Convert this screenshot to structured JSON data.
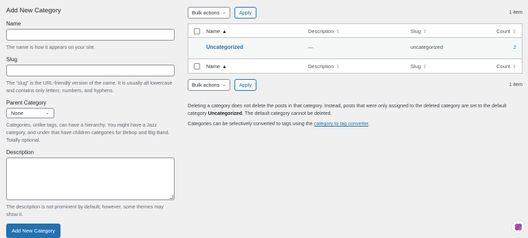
{
  "form": {
    "title": "Add New Category",
    "name_label": "Name",
    "name_value": "",
    "name_help": "The name is how it appears on your site.",
    "slug_label": "Slug",
    "slug_value": "",
    "slug_help": "The “slug” is the URL-friendly version of the name. It is usually all lowercase and contains only letters, numbers, and hyphens.",
    "parent_label": "Parent Category",
    "parent_selected": "None",
    "parent_help": "Categories, unlike tags, can have a hierarchy. You might have a Jazz category, and under that have children categories for Bebop and Big Band. Totally optional.",
    "description_label": "Description",
    "description_value": "",
    "description_help": "The description is not prominent by default; however, some themes may show it.",
    "submit_label": "Add New Category"
  },
  "tablenav": {
    "bulk_label": "Bulk actions",
    "apply_label": "Apply",
    "item_count": "1 item"
  },
  "table": {
    "columns": [
      "Name",
      "Description",
      "Slug",
      "Count"
    ],
    "rows": [
      {
        "name": "Uncategorized",
        "description": "—",
        "slug": "uncategorized",
        "count": "2"
      }
    ]
  },
  "notes": {
    "p1_a": "Deleting a category does not delete the posts in that category. Instead, posts that were only assigned to the deleted category are set to the default category ",
    "p1_bold": "Uncategorized",
    "p1_b": ". The default category cannot be deleted.",
    "p2_a": "Categories can be selectively converted to tags using the ",
    "p2_link": "category to tag converter",
    "p2_b": "."
  },
  "colors": {
    "accent": "#2271b1",
    "background": "#f0f0f1",
    "border": "#c3c4c7"
  },
  "icons": {
    "sort": "sort-arrows-icon",
    "chevron": "chevron-down-icon",
    "assistant": "assistant-bubble-icon"
  }
}
